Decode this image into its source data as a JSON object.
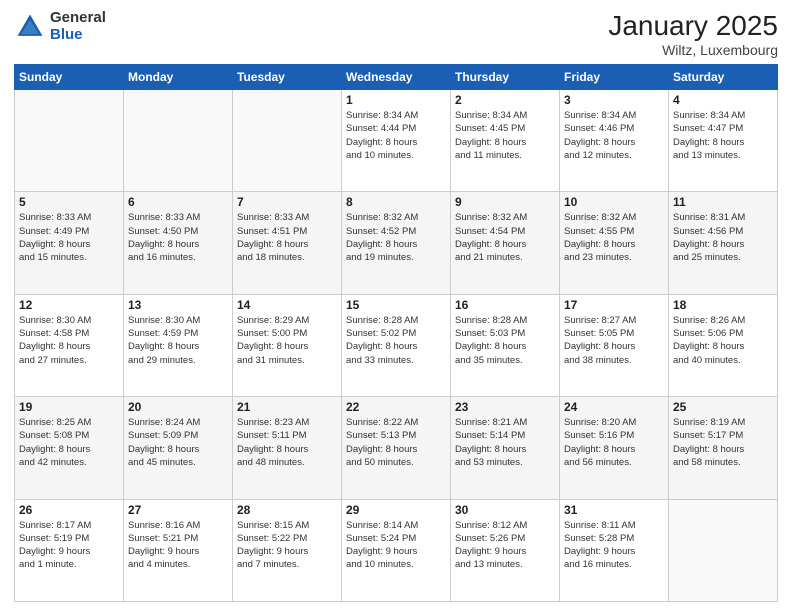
{
  "header": {
    "logo_general": "General",
    "logo_blue": "Blue",
    "month_title": "January 2025",
    "subtitle": "Wiltz, Luxembourg"
  },
  "days_of_week": [
    "Sunday",
    "Monday",
    "Tuesday",
    "Wednesday",
    "Thursday",
    "Friday",
    "Saturday"
  ],
  "weeks": [
    [
      {
        "day": "",
        "info": ""
      },
      {
        "day": "",
        "info": ""
      },
      {
        "day": "",
        "info": ""
      },
      {
        "day": "1",
        "info": "Sunrise: 8:34 AM\nSunset: 4:44 PM\nDaylight: 8 hours\nand 10 minutes."
      },
      {
        "day": "2",
        "info": "Sunrise: 8:34 AM\nSunset: 4:45 PM\nDaylight: 8 hours\nand 11 minutes."
      },
      {
        "day": "3",
        "info": "Sunrise: 8:34 AM\nSunset: 4:46 PM\nDaylight: 8 hours\nand 12 minutes."
      },
      {
        "day": "4",
        "info": "Sunrise: 8:34 AM\nSunset: 4:47 PM\nDaylight: 8 hours\nand 13 minutes."
      }
    ],
    [
      {
        "day": "5",
        "info": "Sunrise: 8:33 AM\nSunset: 4:49 PM\nDaylight: 8 hours\nand 15 minutes."
      },
      {
        "day": "6",
        "info": "Sunrise: 8:33 AM\nSunset: 4:50 PM\nDaylight: 8 hours\nand 16 minutes."
      },
      {
        "day": "7",
        "info": "Sunrise: 8:33 AM\nSunset: 4:51 PM\nDaylight: 8 hours\nand 18 minutes."
      },
      {
        "day": "8",
        "info": "Sunrise: 8:32 AM\nSunset: 4:52 PM\nDaylight: 8 hours\nand 19 minutes."
      },
      {
        "day": "9",
        "info": "Sunrise: 8:32 AM\nSunset: 4:54 PM\nDaylight: 8 hours\nand 21 minutes."
      },
      {
        "day": "10",
        "info": "Sunrise: 8:32 AM\nSunset: 4:55 PM\nDaylight: 8 hours\nand 23 minutes."
      },
      {
        "day": "11",
        "info": "Sunrise: 8:31 AM\nSunset: 4:56 PM\nDaylight: 8 hours\nand 25 minutes."
      }
    ],
    [
      {
        "day": "12",
        "info": "Sunrise: 8:30 AM\nSunset: 4:58 PM\nDaylight: 8 hours\nand 27 minutes."
      },
      {
        "day": "13",
        "info": "Sunrise: 8:30 AM\nSunset: 4:59 PM\nDaylight: 8 hours\nand 29 minutes."
      },
      {
        "day": "14",
        "info": "Sunrise: 8:29 AM\nSunset: 5:00 PM\nDaylight: 8 hours\nand 31 minutes."
      },
      {
        "day": "15",
        "info": "Sunrise: 8:28 AM\nSunset: 5:02 PM\nDaylight: 8 hours\nand 33 minutes."
      },
      {
        "day": "16",
        "info": "Sunrise: 8:28 AM\nSunset: 5:03 PM\nDaylight: 8 hours\nand 35 minutes."
      },
      {
        "day": "17",
        "info": "Sunrise: 8:27 AM\nSunset: 5:05 PM\nDaylight: 8 hours\nand 38 minutes."
      },
      {
        "day": "18",
        "info": "Sunrise: 8:26 AM\nSunset: 5:06 PM\nDaylight: 8 hours\nand 40 minutes."
      }
    ],
    [
      {
        "day": "19",
        "info": "Sunrise: 8:25 AM\nSunset: 5:08 PM\nDaylight: 8 hours\nand 42 minutes."
      },
      {
        "day": "20",
        "info": "Sunrise: 8:24 AM\nSunset: 5:09 PM\nDaylight: 8 hours\nand 45 minutes."
      },
      {
        "day": "21",
        "info": "Sunrise: 8:23 AM\nSunset: 5:11 PM\nDaylight: 8 hours\nand 48 minutes."
      },
      {
        "day": "22",
        "info": "Sunrise: 8:22 AM\nSunset: 5:13 PM\nDaylight: 8 hours\nand 50 minutes."
      },
      {
        "day": "23",
        "info": "Sunrise: 8:21 AM\nSunset: 5:14 PM\nDaylight: 8 hours\nand 53 minutes."
      },
      {
        "day": "24",
        "info": "Sunrise: 8:20 AM\nSunset: 5:16 PM\nDaylight: 8 hours\nand 56 minutes."
      },
      {
        "day": "25",
        "info": "Sunrise: 8:19 AM\nSunset: 5:17 PM\nDaylight: 8 hours\nand 58 minutes."
      }
    ],
    [
      {
        "day": "26",
        "info": "Sunrise: 8:17 AM\nSunset: 5:19 PM\nDaylight: 9 hours\nand 1 minute."
      },
      {
        "day": "27",
        "info": "Sunrise: 8:16 AM\nSunset: 5:21 PM\nDaylight: 9 hours\nand 4 minutes."
      },
      {
        "day": "28",
        "info": "Sunrise: 8:15 AM\nSunset: 5:22 PM\nDaylight: 9 hours\nand 7 minutes."
      },
      {
        "day": "29",
        "info": "Sunrise: 8:14 AM\nSunset: 5:24 PM\nDaylight: 9 hours\nand 10 minutes."
      },
      {
        "day": "30",
        "info": "Sunrise: 8:12 AM\nSunset: 5:26 PM\nDaylight: 9 hours\nand 13 minutes."
      },
      {
        "day": "31",
        "info": "Sunrise: 8:11 AM\nSunset: 5:28 PM\nDaylight: 9 hours\nand 16 minutes."
      },
      {
        "day": "",
        "info": ""
      }
    ]
  ]
}
